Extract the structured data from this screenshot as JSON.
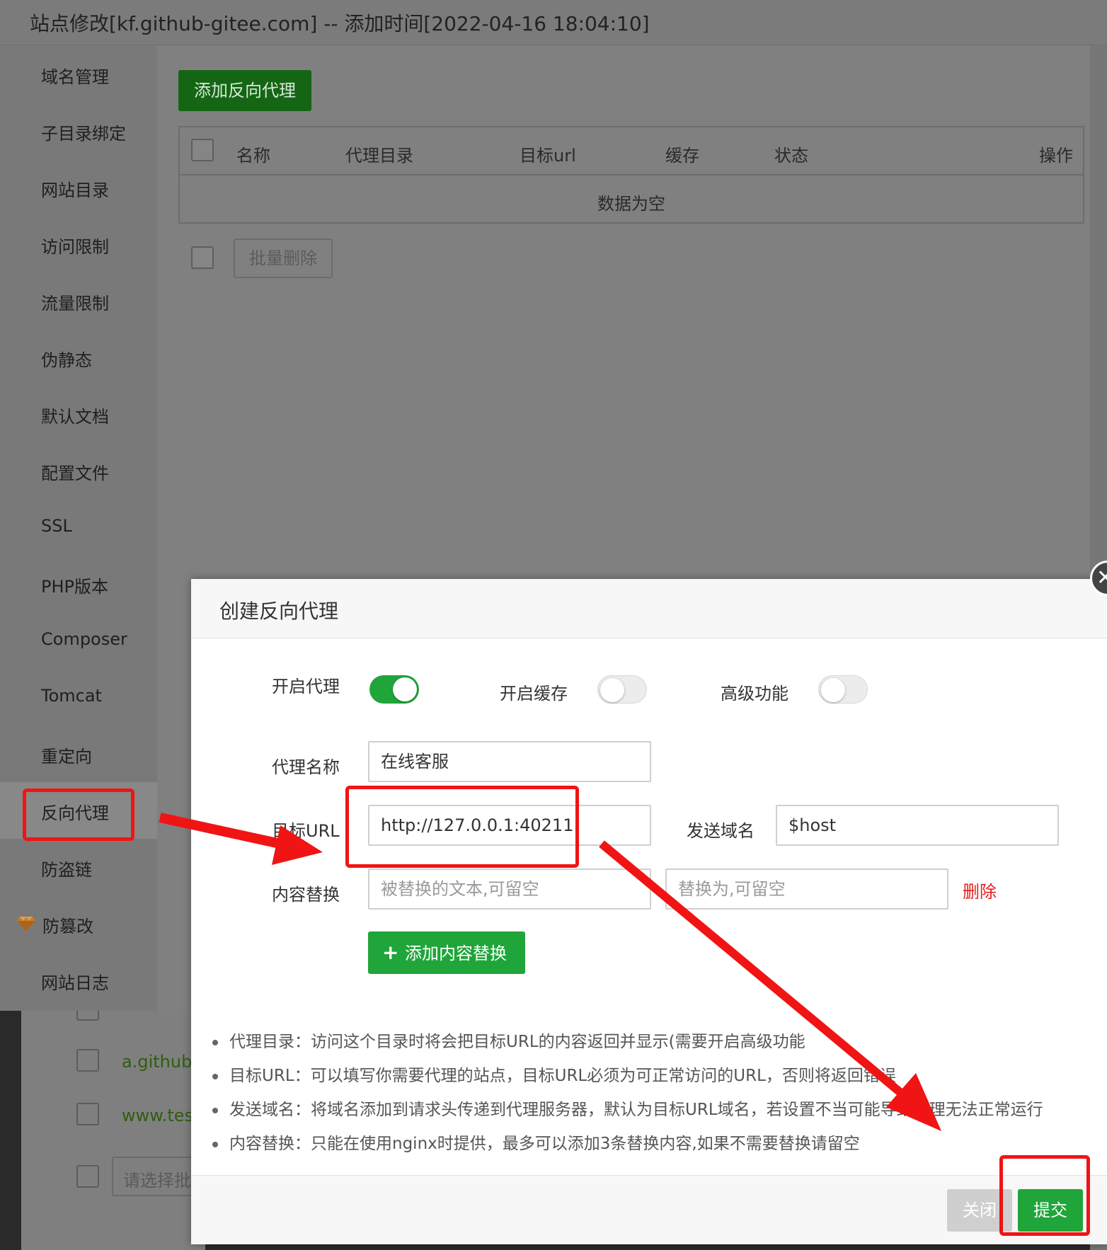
{
  "window": {
    "title": "站点修改[kf.github-gitee.com] -- 添加时间[2022-04-16 18:04:10]"
  },
  "sidebar": {
    "items": [
      {
        "label": "域名管理"
      },
      {
        "label": "子目录绑定"
      },
      {
        "label": "网站目录"
      },
      {
        "label": "访问限制"
      },
      {
        "label": "流量限制"
      },
      {
        "label": "伪静态"
      },
      {
        "label": "默认文档"
      },
      {
        "label": "配置文件"
      },
      {
        "label": "SSL"
      },
      {
        "label": "PHP版本"
      },
      {
        "label": "Composer"
      },
      {
        "label": "Tomcat"
      },
      {
        "label": "重定向"
      },
      {
        "label": "反向代理"
      },
      {
        "label": "防盗链"
      },
      {
        "label": "防篡改",
        "icon": "gem-icon"
      },
      {
        "label": "网站日志"
      }
    ],
    "active": "反向代理"
  },
  "proxy_panel": {
    "add_button": "添加反向代理",
    "columns": [
      "名称",
      "代理目录",
      "目标url",
      "缓存",
      "状态",
      "操作"
    ],
    "empty_text": "数据为空",
    "batch_delete": "批量删除"
  },
  "background_list": {
    "rows": [
      "a.github-",
      "www.test"
    ],
    "select_placeholder": "请选择批"
  },
  "modal": {
    "title": "创建反向代理",
    "toggles": [
      {
        "label": "开启代理",
        "on": true
      },
      {
        "label": "开启缓存",
        "on": false
      },
      {
        "label": "高级功能",
        "on": false
      }
    ],
    "proxy_name": {
      "label": "代理名称",
      "value": "在线客服"
    },
    "target_url": {
      "label": "目标URL",
      "value": "http://127.0.0.1:40211"
    },
    "send_domain": {
      "label": "发送域名",
      "value": "$host"
    },
    "content_replace": {
      "label": "内容替换",
      "from_placeholder": "被替换的文本,可留空",
      "to_placeholder": "替换为,可留空",
      "delete_label": "删除"
    },
    "add_replace_button": "添加内容替换",
    "tips": [
      "代理目录：访问这个目录时将会把目标URL的内容返回并显示(需要开启高级功能",
      "目标URL：可以填写你需要代理的站点，目标URL必须为可正常访问的URL，否则将返回错误",
      "发送域名：将域名添加到请求头传递到代理服务器，默认为目标URL域名，若设置不当可能导致代理无法正常运行",
      "内容替换：只能在使用nginx时提供，最多可以添加3条替换内容,如果不需要替换请留空"
    ],
    "close_button": "关闭",
    "submit_button": "提交"
  },
  "annotation_color": "#f01414",
  "accent_color": "#20a53a"
}
